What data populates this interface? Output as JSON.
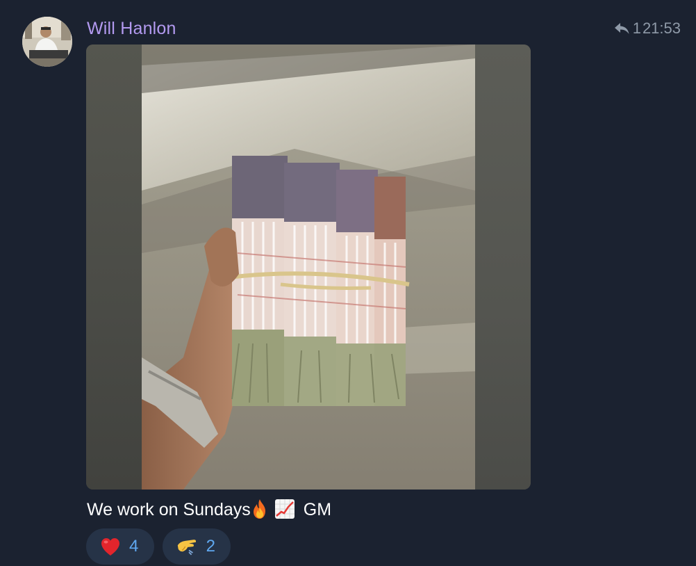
{
  "message": {
    "author": "Will Hanlon",
    "reply_count": "1",
    "time": "21:53",
    "caption_text": "We work on Sundays",
    "caption_emojis": [
      "fire-emoji",
      "chart-increasing-emoji"
    ],
    "caption_suffix": "GM",
    "accent_color": "#b39af0",
    "background_color": "#1b2230"
  },
  "reactions": [
    {
      "emoji": "red-heart",
      "count": "4"
    },
    {
      "emoji": "saluting-hand",
      "count": "2"
    }
  ],
  "icons": {
    "reply": "reply-arrow-icon"
  }
}
